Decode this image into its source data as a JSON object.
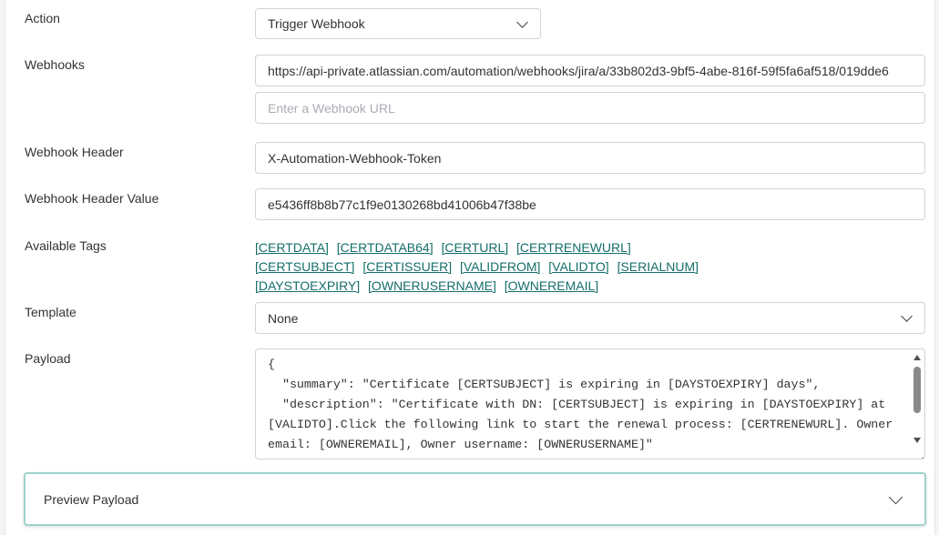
{
  "form": {
    "action": {
      "label": "Action",
      "value": "Trigger Webhook"
    },
    "webhooks": {
      "label": "Webhooks",
      "url_value": "https://api-private.atlassian.com/automation/webhooks/jira/a/33b802d3-9bf5-4abe-816f-59f5fa6af518/019dde6",
      "new_url_placeholder": "Enter a Webhook URL"
    },
    "header": {
      "label": "Webhook Header",
      "value": "X-Automation-Webhook-Token"
    },
    "header_value": {
      "label": "Webhook Header Value",
      "value": "e5436ff8b8b77c1f9e0130268bd41006b47f38be"
    },
    "tags": {
      "label": "Available Tags",
      "rows": [
        [
          "[CERTDATA]",
          "[CERTDATAB64]",
          "[CERTURL]",
          "[CERTRENEWURL]"
        ],
        [
          "[CERTSUBJECT]",
          "[CERTISSUER]",
          "[VALIDFROM]",
          "[VALIDTO]",
          "[SERIALNUM]"
        ],
        [
          "[DAYSTOEXPIRY]",
          "[OWNERUSERNAME]",
          "[OWNEREMAIL]"
        ]
      ]
    },
    "template": {
      "label": "Template",
      "value": "None"
    },
    "payload": {
      "label": "Payload",
      "value": "{\n  \"summary\": \"Certificate [CERTSUBJECT] is expiring in [DAYSTOEXPIRY] days\",\n  \"description\": \"Certificate with DN: [CERTSUBJECT] is expiring in [DAYSTOEXPIRY] at [VALIDTO].Click the following link to start the renewal process: [CERTRENEWURL]. Owner email: [OWNEREMAIL], Owner username: [OWNERUSERNAME]\"\n}"
    },
    "preview": {
      "label": "Preview Payload"
    }
  },
  "icons": {
    "action_dropdown": "chevron-down-icon",
    "template_dropdown": "chevron-down-icon",
    "preview_toggle": "chevron-down-icon"
  },
  "colors": {
    "tag_link": "#146e6a",
    "preview_border": "#9fd3cc"
  }
}
